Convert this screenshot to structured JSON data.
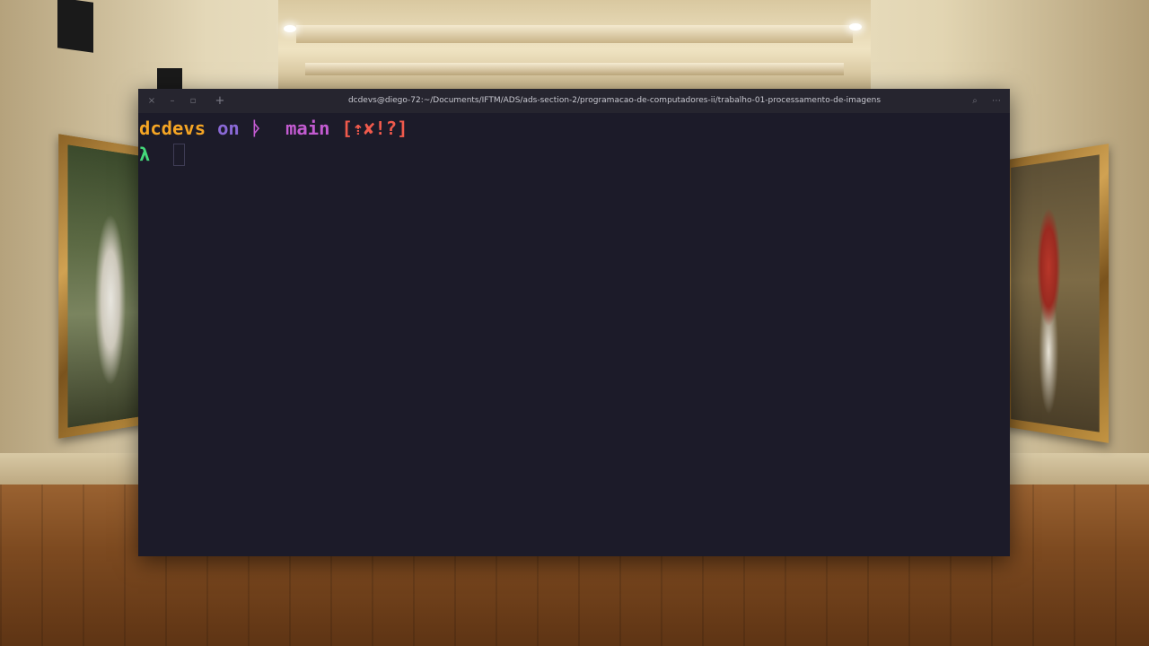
{
  "window": {
    "title": "dcdevs@diego-72:~/Documents/IFTM/ADS/ads-section-2/programacao-de-computadores-ii/trabalho-01-processamento-de-imagens",
    "controls": {
      "close_icon": "×",
      "minimize_icon": "–",
      "maximize_icon": "▫",
      "new_tab_icon": "+",
      "search_icon": "⌕",
      "menu_icon": "⋯"
    }
  },
  "prompt": {
    "user": "dcdevs",
    "on": "on",
    "branch_icon": "ᚦ",
    "branch": "main",
    "git_status": "[⇡✘!?]",
    "symbol": "λ"
  },
  "colors": {
    "terminal_bg": "#1c1b29",
    "user": "#f5a524",
    "on": "#8a69d6",
    "branch": "#c35bd1",
    "git_status": "#f05a4c",
    "lambda": "#44d97a"
  },
  "wallpaper": "museum-gallery"
}
